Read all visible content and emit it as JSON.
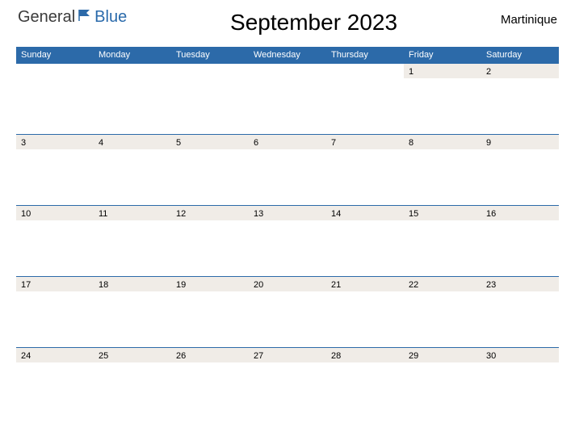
{
  "brand": {
    "part1": "General",
    "part2": "Blue"
  },
  "title": "September 2023",
  "region": "Martinique",
  "daysOfWeek": [
    "Sunday",
    "Monday",
    "Tuesday",
    "Wednesday",
    "Thursday",
    "Friday",
    "Saturday"
  ],
  "weeks": [
    [
      "",
      "",
      "",
      "",
      "",
      "1",
      "2"
    ],
    [
      "3",
      "4",
      "5",
      "6",
      "7",
      "8",
      "9"
    ],
    [
      "10",
      "11",
      "12",
      "13",
      "14",
      "15",
      "16"
    ],
    [
      "17",
      "18",
      "19",
      "20",
      "21",
      "22",
      "23"
    ],
    [
      "24",
      "25",
      "26",
      "27",
      "28",
      "29",
      "30"
    ]
  ],
  "colors": {
    "brand": "#2c6aa9",
    "rowStripe": "#f0ece7"
  }
}
